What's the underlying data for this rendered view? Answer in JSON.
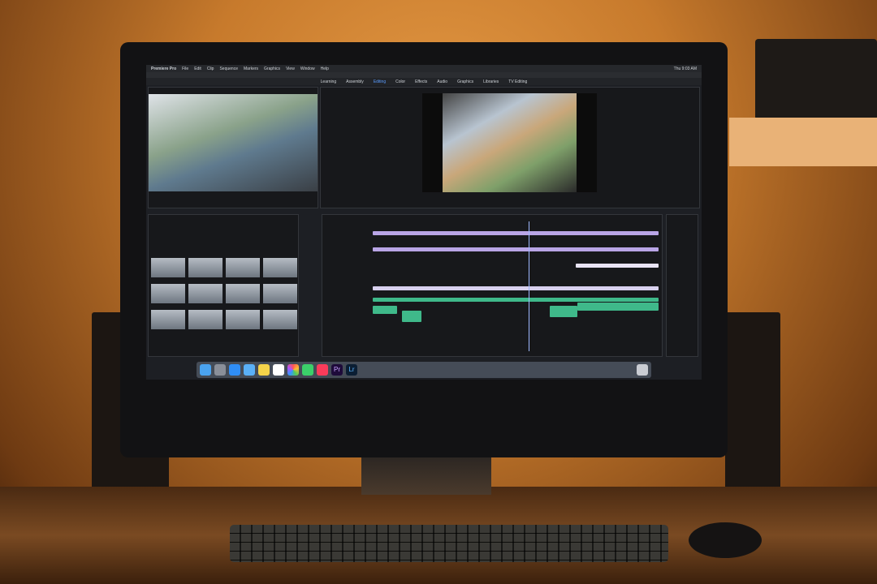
{
  "menubar": {
    "app": "Premiere Pro",
    "items": [
      "File",
      "Edit",
      "Clip",
      "Sequence",
      "Markers",
      "Graphics",
      "View",
      "Window",
      "Help"
    ],
    "clock": "Thu 9:03 AM"
  },
  "workspaces": {
    "items": [
      "Learning",
      "Assembly",
      "Editing",
      "Color",
      "Effects",
      "Audio",
      "Graphics",
      "Libraries",
      "TV Editing"
    ],
    "active": "Editing"
  },
  "colors": {
    "accent": "#5a9cff",
    "audio_clips": "#3fb98a",
    "video_clips": "#b9a5e6",
    "wall": "#e59a45"
  },
  "dock": {
    "icons": [
      "finder-icon",
      "launchpad-icon",
      "safari-icon",
      "mail-icon",
      "notes-icon",
      "calendar-icon",
      "photos-icon",
      "messages-icon",
      "music-icon",
      "premiere-pro-icon",
      "lightroom-icon",
      "trash-icon"
    ],
    "labels": {
      "premiere": "Pr",
      "lightroom": "Lr"
    }
  }
}
